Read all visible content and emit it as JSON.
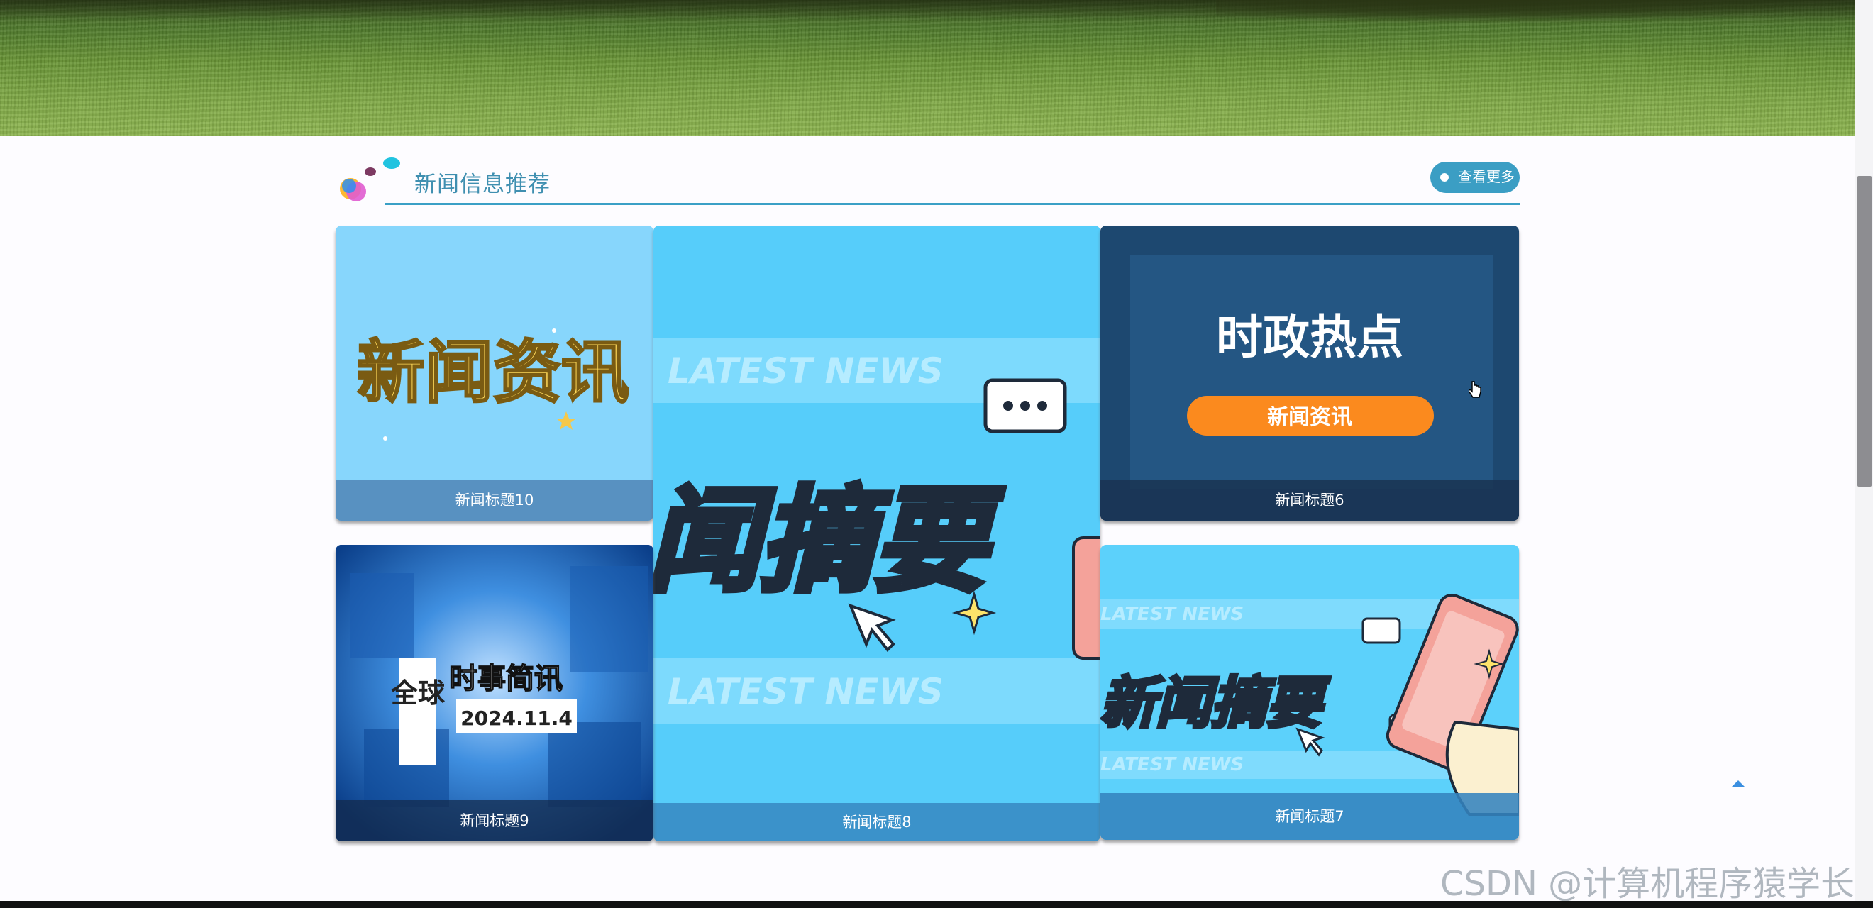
{
  "section": {
    "title": "新闻信息推荐",
    "more_label": "查看更多"
  },
  "news": [
    {
      "title": "新闻标题10",
      "image_text": "新闻资讯"
    },
    {
      "title": "新闻标题8",
      "image_text": "闻摘要",
      "banner": "LATEST NEWS"
    },
    {
      "title": "新闻标题6",
      "image_text": "时政热点",
      "image_button": "新闻资讯"
    },
    {
      "title": "新闻标题9",
      "image_text_a": "全球",
      "image_text_b": "时事简讯",
      "image_date": "2024.11.4"
    },
    {
      "title": "新闻标题7",
      "image_text": "新闻摘要",
      "banner": "LATEST NEWS"
    }
  ],
  "watermark": "CSDN @计算机程序猿学长",
  "colors": {
    "accent": "#3b9ec4",
    "title": "#3f8fb0"
  },
  "icons": [
    "bubbles-logo-icon",
    "back-to-top-icon",
    "pointer-cursor-icon"
  ]
}
